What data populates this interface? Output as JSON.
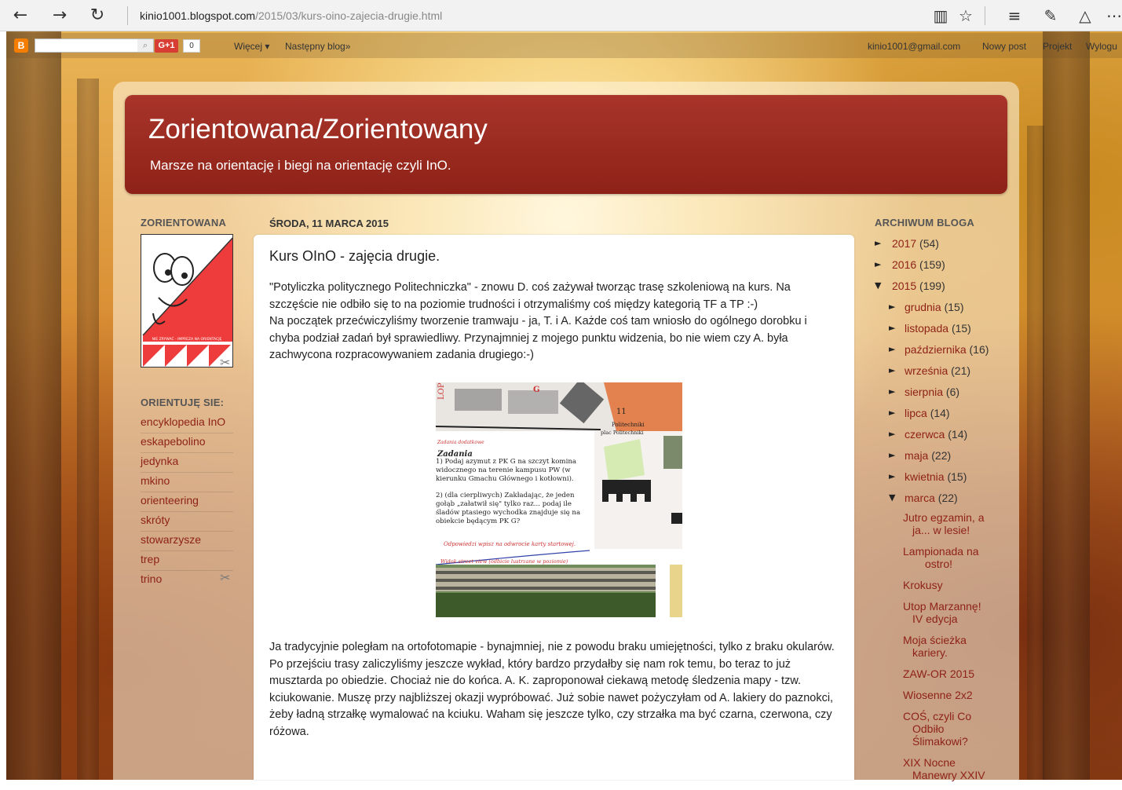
{
  "browser": {
    "url_host": "kinio1001.blogspot.com",
    "url_path": "/2015/03/kurs-oino-zajecia-drugie.html"
  },
  "navbar": {
    "gplus_label": "G+1",
    "gplus_count": "0",
    "more_label": "Więcej ▾",
    "next_blog_label": "Następny blog»",
    "email": "kinio1001@gmail.com",
    "new_post": "Nowy post",
    "design": "Projekt",
    "logout": "Wylogu"
  },
  "header": {
    "title": "Zorientowana/Zorientowany",
    "description": "Marsze na orientację i biegi na orientację czyli InO."
  },
  "left_sidebar": {
    "profile_heading": "ZORIENTOWANA",
    "profile_caption": "NIE ZRYWAĆ - IMPREZA NA ORIENTACJĘ",
    "links_heading": "ORIENTUJĘ SIE:",
    "links": [
      "encyklopedia InO",
      "eskapebolino",
      "jedynka",
      "mkino",
      "orienteering",
      "skróty",
      "stowarzysze",
      "trep",
      "trino"
    ]
  },
  "post": {
    "date": "ŚRODA, 11 MARCA 2015",
    "title": "Kurs OInO - zajęcia drugie.",
    "para1": "\"Potyliczka politycznego Politechniczka\" - znowu D. coś zażywał tworząc trasę szkoleniową na kurs. Na szczęście nie odbiło się to na poziomie trudności i otrzymaliśmy coś między kategorią TF a TP :-)",
    "para2": "Na początek przećwiczyliśmy tworzenie tramwaju - ja, T. i A. Każde coś tam wniosło do ogólnego dorobku i chyba podział zadań był sprawiedliwy. Przynajmniej z mojego punktu widzenia, bo nie wiem czy A. była zachwycona rozpracowywaniem zadania drugiego:-)",
    "para3": "Ja tradycyjnie poległam na ortofotomapie - bynajmniej, nie z powodu braku umiejętności, tylko z braku okularów.",
    "para4": "Po przejściu trasy zaliczyliśmy jeszcze wykład, który bardzo przydałby się nam rok temu, bo teraz to już musztarda po obiedzie. Chociaż nie do końca. A. K. zaproponował ciekawą metodę śledzenia mapy - tzw. kciukowanie. Muszę przy najbliższej okazji wypróbować. Już sobie nawet pożyczyłam od A. lakiery do paznokci, żeby ładną strzałkę wymalować na kciuku. Waham się jeszcze tylko, czy strzałka ma być czarna, czerwona, czy różowa.",
    "figure": {
      "map_label_lop": "LOP",
      "map_label_g": "G",
      "map_label_11": "11",
      "map_label_politechnika": "Politechniki",
      "map_label_plac": "plac Politechniki",
      "sub_label": "Zadania dodatkowe",
      "tasks_heading": "Zadania",
      "task1": "1) Podaj azymut z PK G na szczyt komina widocznego na terenie kampusu PW (w kierunku Gmachu Głównego i kotłowni).",
      "task2": "2) (dla cierpliwych) Zakładając, że jeden gołąb „załatwił się\" tylko raz... podaj ile śladów ptasiego wychodka znajduje się na obiekcie będącym PK G?",
      "answer_note": "Odpowiedzi wpisz na odwrocie karty startowej.",
      "street_note": "Widok street view (odbicie lustrzane w poziomie)"
    }
  },
  "archive": {
    "heading": "ARCHIWUM BLOGA",
    "years": [
      {
        "label": "2017",
        "count": "(54)",
        "marker": "►"
      },
      {
        "label": "2016",
        "count": "(159)",
        "marker": "►"
      },
      {
        "label": "2015",
        "count": "(199)",
        "marker": "▼"
      }
    ],
    "months": [
      {
        "label": "grudnia",
        "count": "(15)",
        "marker": "►"
      },
      {
        "label": "listopada",
        "count": "(15)",
        "marker": "►"
      },
      {
        "label": "października",
        "count": "(16)",
        "marker": "►"
      },
      {
        "label": "września",
        "count": "(21)",
        "marker": "►"
      },
      {
        "label": "sierpnia",
        "count": "(6)",
        "marker": "►"
      },
      {
        "label": "lipca",
        "count": "(14)",
        "marker": "►"
      },
      {
        "label": "czerwca",
        "count": "(14)",
        "marker": "►"
      },
      {
        "label": "maja",
        "count": "(22)",
        "marker": "►"
      },
      {
        "label": "kwietnia",
        "count": "(15)",
        "marker": "►"
      },
      {
        "label": "marca",
        "count": "(22)",
        "marker": "▼"
      }
    ],
    "posts": [
      {
        "line1": "Jutro egzamin, a",
        "line2": "ja... w lesie!"
      },
      {
        "line1": "Lampionada na",
        "line2": "ostro!"
      },
      {
        "line1": "Krokusy",
        "line2": ""
      },
      {
        "line1": "Utop Marzannę!",
        "line2": "IV edycja"
      },
      {
        "line1": "Moja ścieżka",
        "line2": "kariery."
      },
      {
        "line1": "ZAW-OR 2015",
        "line2": ""
      },
      {
        "line1": "Wiosenne 2x2",
        "line2": ""
      },
      {
        "line1": "COŚ, czyli Co",
        "line2": "Odbiło Ślimakowi?"
      },
      {
        "line1": "XIX Nocne",
        "line2": "Manewry XXIV"
      }
    ]
  }
}
